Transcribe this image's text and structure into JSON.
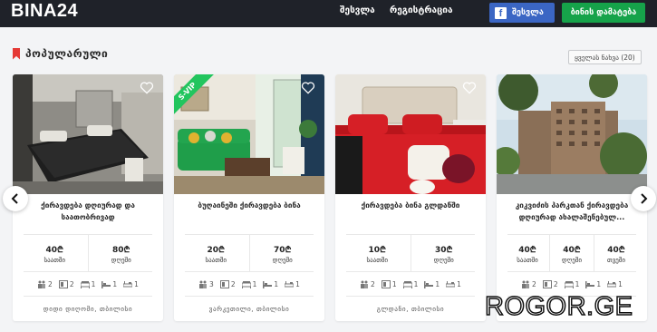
{
  "header": {
    "logo": "BINA24",
    "nav": {
      "login": "შესვლა",
      "register": "რეგისტრაცია"
    },
    "facebook_button": {
      "icon": "f",
      "label": "შესვლა"
    },
    "add_listing_button": "ბინის დამატება"
  },
  "section": {
    "title": "პოპულარული",
    "see_all": "ყველას ნახვა (20)"
  },
  "cards": [
    {
      "title": "ქირავდება დღიურად და საათობრივად",
      "vip": "",
      "prices": [
        {
          "value": "40₾",
          "label": "საათში"
        },
        {
          "value": "80₾",
          "label": "დღეში"
        }
      ],
      "features": {
        "guests": "2",
        "rooms": "2",
        "beds": "1",
        "bedrooms": "1",
        "baths": "1"
      },
      "location": "დიდი დიღომი, თბილისი"
    },
    {
      "title": "ბუღაინეში ქირავდება ბინა",
      "vip": "S-VIP",
      "prices": [
        {
          "value": "20₾",
          "label": "საათში"
        },
        {
          "value": "70₾",
          "label": "დღეში"
        }
      ],
      "features": {
        "guests": "3",
        "rooms": "2",
        "beds": "1",
        "bedrooms": "1",
        "baths": "1"
      },
      "location": "ვარკეთილი, თბილისი"
    },
    {
      "title": "ქირავდება ბინა გლდანში",
      "vip": "",
      "prices": [
        {
          "value": "10₾",
          "label": "საათში"
        },
        {
          "value": "30₾",
          "label": "დღეში"
        }
      ],
      "features": {
        "guests": "2",
        "rooms": "1",
        "beds": "1",
        "bedrooms": "1",
        "baths": "1"
      },
      "location": "გლდანი, თბილისი"
    },
    {
      "title": "კიკვიძის პარკთან ქირავდება დღიურად ახალაშენებულ...",
      "vip": "",
      "prices": [
        {
          "value": "40₾",
          "label": "საათში"
        },
        {
          "value": "40₾",
          "label": "დღეში"
        },
        {
          "value": "40₾",
          "label": "თვეში"
        }
      ],
      "features": {
        "guests": "2",
        "rooms": "2",
        "beds": "1",
        "bedrooms": "1",
        "baths": "1"
      },
      "location": ""
    }
  ],
  "watermark": "ROGOR.GE",
  "colors": {
    "topbar": "#1f2229",
    "facebook": "#3b66c4",
    "add_button": "#16a34a",
    "bookmark": "#e53935",
    "vip": "#22c55e"
  }
}
